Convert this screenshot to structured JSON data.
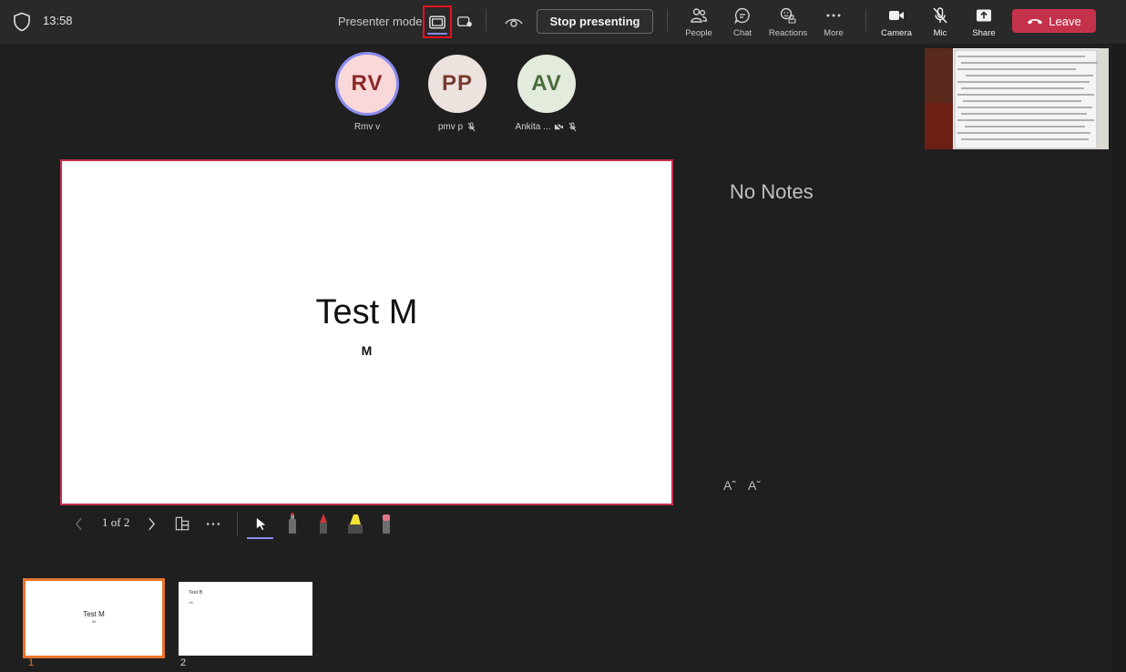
{
  "topbar": {
    "time": "13:58",
    "presenter_mode_label": "Presenter mode",
    "stop_presenting_label": "Stop presenting",
    "tools": [
      {
        "label": "People",
        "icon": "people-icon"
      },
      {
        "label": "Chat",
        "icon": "chat-icon"
      },
      {
        "label": "Reactions",
        "icon": "reactions-icon"
      },
      {
        "label": "More",
        "icon": "more-icon"
      },
      {
        "label": "Camera",
        "icon": "camera-icon"
      },
      {
        "label": "Mic",
        "icon": "mic-off-icon"
      },
      {
        "label": "Share",
        "icon": "share-icon"
      }
    ],
    "leave_label": "Leave",
    "leave_color": "#c4314b",
    "accent_color": "#8b8cf0"
  },
  "participants": [
    {
      "initials": "RV",
      "name": "Rmv v",
      "bg": "#f8d8d8",
      "fg": "#8a2a2a",
      "active": true,
      "muted": false
    },
    {
      "initials": "PP",
      "name": "pmv p",
      "bg": "#ece2de",
      "fg": "#7a3b32",
      "active": false,
      "muted": true
    },
    {
      "initials": "AV",
      "name": "Ankita ...",
      "bg": "#e3ebdc",
      "fg": "#4a6b3a",
      "active": false,
      "muted": true,
      "camera_off": true
    }
  ],
  "slide": {
    "title": "Test M",
    "subtitle": "M"
  },
  "notes": {
    "text": "No Notes",
    "increase_font": "Aˆ",
    "decrease_font": "Aˇ"
  },
  "slide_toolbar": {
    "page_indicator": "1 of 2"
  },
  "thumbnails": [
    {
      "number": "1",
      "title": "Test M",
      "subtitle": "M",
      "selected": true
    },
    {
      "number": "2",
      "title": "Test B",
      "subtitle": "• B",
      "selected": false
    }
  ]
}
